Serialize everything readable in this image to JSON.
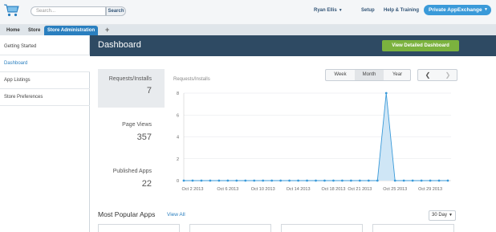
{
  "header": {
    "search_placeholder": "Search...",
    "search_button": "Search",
    "user_name": "Ryan Ellis",
    "links": [
      "Setup",
      "Help & Training"
    ],
    "app_switcher": "Private AppExchange",
    "brand_color": "#3a9ad9"
  },
  "tabs": {
    "items": [
      "Home",
      "Store",
      "Store Administration"
    ],
    "active": "Store Administration",
    "add_symbol": "+"
  },
  "sidebar": {
    "items": [
      {
        "label": "Getting Started"
      },
      {
        "label": "Dashboard"
      },
      {
        "label": "App Listings"
      },
      {
        "label": "Store Preferences"
      }
    ],
    "active": "Dashboard"
  },
  "main": {
    "title": "Dashboard",
    "detailed_button": "View Detailed Dashboard"
  },
  "stats": [
    {
      "label": "Requests/Installs",
      "value": "7"
    },
    {
      "label": "Page Views",
      "value": "357"
    },
    {
      "label": "Published Apps",
      "value": "22"
    }
  ],
  "range": {
    "options": [
      "Week",
      "Month",
      "Year"
    ],
    "selected": "Month",
    "prev_symbol": "❮",
    "next_symbol": "❯"
  },
  "popular": {
    "title": "Most Popular Apps",
    "view_all": "View All",
    "period": "30 Day"
  },
  "chart_data": {
    "type": "area",
    "title": "Requests/Installs",
    "ylim": [
      0,
      8
    ],
    "yticks": [
      0,
      2,
      4,
      6,
      8
    ],
    "x_labels": [
      "Oct 2 2013",
      "Oct 6 2013",
      "Oct 10 2013",
      "Oct 14 2013",
      "Oct 18 2013",
      "Oct 21 2013",
      "Oct 25 2013",
      "Oct 29 2013"
    ],
    "x_label_index": [
      1,
      5,
      9,
      13,
      17,
      20,
      24,
      28
    ],
    "values": [
      0,
      0,
      0,
      0,
      0,
      0,
      0,
      0,
      0,
      0,
      0,
      0,
      0,
      0,
      0,
      0,
      0,
      0,
      0,
      0,
      0,
      0,
      0,
      8,
      0,
      0,
      0,
      0,
      0,
      0,
      0
    ],
    "grid": true,
    "color": "#3a9ad9"
  }
}
